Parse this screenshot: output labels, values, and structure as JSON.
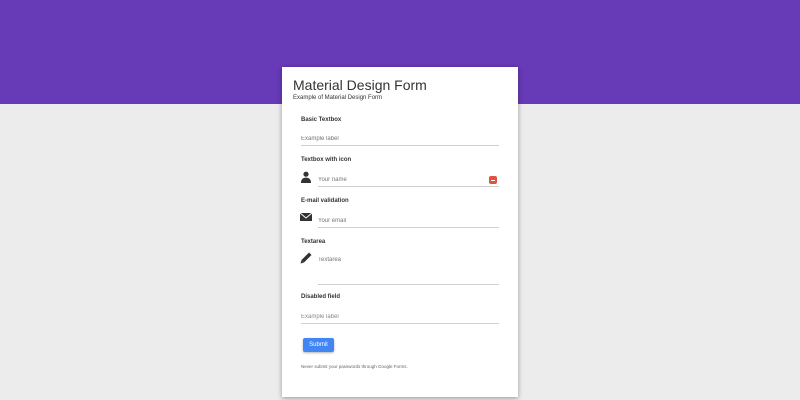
{
  "colors": {
    "header": "#673ab7",
    "background": "#ececec",
    "card": "#ffffff",
    "primary_button": "#4285f4",
    "clear_button": "#e0533f"
  },
  "form": {
    "title": "Material Design Form",
    "subtitle": "Example of Material Design Form",
    "fields": {
      "basic": {
        "label": "Basic Textbox",
        "placeholder": "Example label"
      },
      "with_icon": {
        "label": "Textbox with icon",
        "placeholder": "Your name",
        "icon": "user-icon"
      },
      "email": {
        "label": "E-mail validation",
        "placeholder": "Your email",
        "icon": "envelope-icon"
      },
      "textarea": {
        "label": "Textarea",
        "placeholder": "Textarea",
        "icon": "pencil-icon"
      },
      "disabled": {
        "label": "Disabled field",
        "placeholder": "Example label"
      }
    },
    "submit_label": "Submit",
    "footer_note": "Never submit your passwords through Google Forms."
  }
}
